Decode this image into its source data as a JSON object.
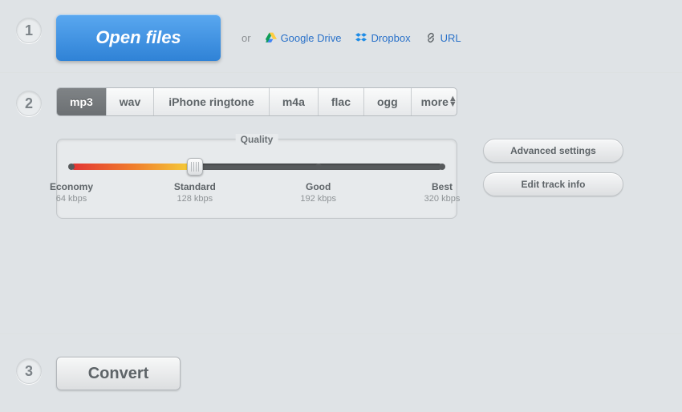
{
  "steps": {
    "one": "1",
    "two": "2",
    "three": "3"
  },
  "open": {
    "button": "Open files",
    "or": "or",
    "sources": {
      "gdrive": "Google Drive",
      "dropbox": "Dropbox",
      "url": "URL"
    }
  },
  "formats": {
    "mp3": "mp3",
    "wav": "wav",
    "iphone": "iPhone ringtone",
    "m4a": "m4a",
    "flac": "flac",
    "ogg": "ogg",
    "more": "more"
  },
  "quality": {
    "title": "Quality",
    "selected_index": 1,
    "stops": [
      {
        "name": "Economy",
        "rate": "64 kbps",
        "pos": 0
      },
      {
        "name": "Standard",
        "rate": "128 kbps",
        "pos": 33.3
      },
      {
        "name": "Good",
        "rate": "192 kbps",
        "pos": 66.6
      },
      {
        "name": "Best",
        "rate": "320 kbps",
        "pos": 100
      }
    ]
  },
  "side": {
    "advanced": "Advanced settings",
    "edittrack": "Edit track info"
  },
  "convert": {
    "button": "Convert"
  }
}
